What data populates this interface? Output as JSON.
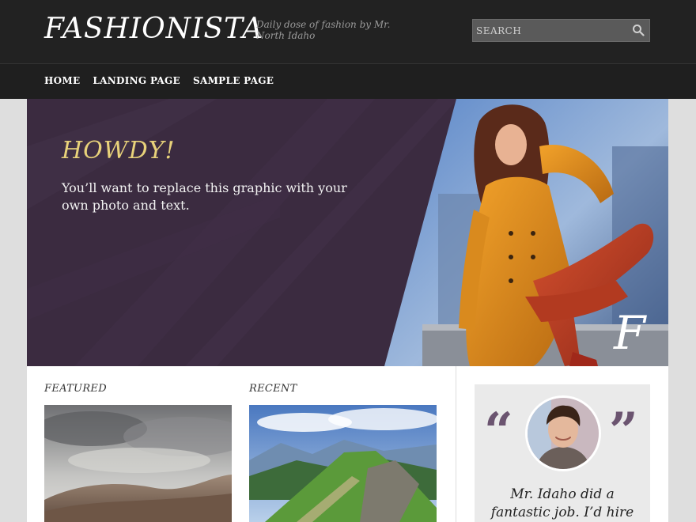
{
  "site": {
    "title": "FASHIONISTA",
    "tagline": "Daily dose of fashion by Mr. North Idaho"
  },
  "search": {
    "placeholder": "SEARCH",
    "icon": "search-icon"
  },
  "nav": {
    "items": [
      {
        "label": "HOME"
      },
      {
        "label": "LANDING PAGE"
      },
      {
        "label": "SAMPLE PAGE"
      }
    ]
  },
  "hero": {
    "title": "HOWDY!",
    "text": "You’ll want to replace this graphic with your own photo and text.",
    "mark": "F"
  },
  "sections": {
    "featured_label": "FEATURED",
    "recent_label": "RECENT"
  },
  "testimonial": {
    "open_quote": "“",
    "close_quote": "”",
    "text": "Mr. Idaho did a fantastic job. I’d hire"
  },
  "colors": {
    "header_bg": "#222222",
    "hero_bg": "#3b2b40",
    "hero_title": "#e8d27a",
    "quote_accent": "#6b5470"
  }
}
